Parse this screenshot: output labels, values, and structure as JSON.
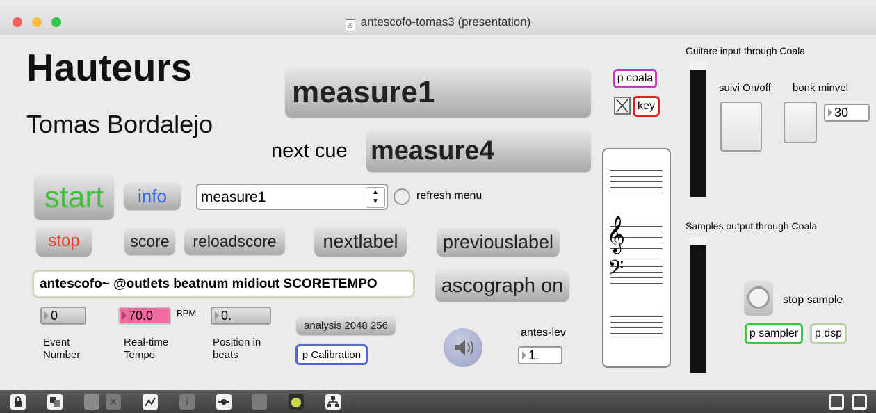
{
  "window": {
    "title": "antescofo-tomas3 (presentation)"
  },
  "traffic_lights": {
    "close": "#fc605c",
    "minimize": "#fdbc40",
    "zoom": "#34c84a"
  },
  "header": {
    "title": "Hauteurs",
    "composer": "Tomas Bordalejo"
  },
  "cues": {
    "current": "measure1",
    "next_label": "next cue",
    "next": "measure4"
  },
  "buttons": {
    "start": "start",
    "info": "info",
    "stop": "stop",
    "score": "score",
    "reloadscore": "reloadscore",
    "nextlabel": "nextlabel",
    "previouslabel": "previouslabel",
    "ascograph": "ascograph on",
    "analysis": "analysis 2048 256"
  },
  "menu": {
    "selected": "measure1",
    "refresh_label": "refresh menu"
  },
  "antescofo_object": "antescofo~ @outlets beatnum midiout SCORETEMPO",
  "displays": {
    "event_number": {
      "value": "0",
      "label": "Event Number"
    },
    "tempo": {
      "value": "70.0",
      "unit": "BPM",
      "label": "Real-time Tempo"
    },
    "position": {
      "value": "0.",
      "label": "Position in beats"
    }
  },
  "calibration": "p Calibration",
  "antes_lev": {
    "label": "antes-lev",
    "value": "1."
  },
  "coala": {
    "p_coala": "p coala",
    "key": "key"
  },
  "guitar": {
    "title": "Guitare input through Coala",
    "suivi_label": "suivi On/off",
    "bonk_label": "bonk minvel",
    "bonk_value": "30"
  },
  "samples": {
    "title": "Samples output through Coala",
    "stop_label": "stop sample",
    "sampler": "p sampler",
    "dsp": "p dsp"
  },
  "colors": {
    "start_text": "#3fc23a",
    "info_text": "#3366ee",
    "stop_text": "#f23a2a",
    "tempo_bg": "#f06ba0",
    "calibration_border": "#5566cc",
    "coala_border": "#cc33cc",
    "key_border": "#e02020",
    "sampler_border": "#33cc33",
    "dsp_border": "#b8d0a8"
  },
  "toolbar_icons": [
    "lock-icon",
    "presentation-icon",
    "edit-icon",
    "close-icon",
    "graph-icon",
    "info-icon",
    "toggle-icon",
    "grid-icon",
    "color-icon",
    "hierarchy-icon",
    "split-view-icon"
  ]
}
